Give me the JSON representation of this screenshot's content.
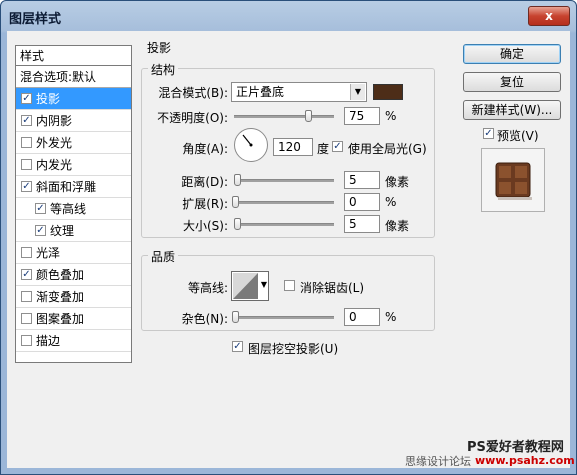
{
  "window": {
    "title": "图层样式",
    "close_label": "x"
  },
  "styles_panel": {
    "header": "样式",
    "blend_options": "混合选项:默认",
    "items": [
      {
        "label": "投影",
        "checked": true,
        "selected": true,
        "sub": false
      },
      {
        "label": "内阴影",
        "checked": true,
        "selected": false,
        "sub": false
      },
      {
        "label": "外发光",
        "checked": false,
        "selected": false,
        "sub": false
      },
      {
        "label": "内发光",
        "checked": false,
        "selected": false,
        "sub": false
      },
      {
        "label": "斜面和浮雕",
        "checked": true,
        "selected": false,
        "sub": false
      },
      {
        "label": "等高线",
        "checked": true,
        "selected": false,
        "sub": true
      },
      {
        "label": "纹理",
        "checked": true,
        "selected": false,
        "sub": true
      },
      {
        "label": "光泽",
        "checked": false,
        "selected": false,
        "sub": false
      },
      {
        "label": "颜色叠加",
        "checked": true,
        "selected": false,
        "sub": false
      },
      {
        "label": "渐变叠加",
        "checked": false,
        "selected": false,
        "sub": false
      },
      {
        "label": "图案叠加",
        "checked": false,
        "selected": false,
        "sub": false
      },
      {
        "label": "描边",
        "checked": false,
        "selected": false,
        "sub": false
      }
    ]
  },
  "drop_shadow": {
    "section_title": "投影",
    "structure": {
      "title": "结构",
      "blend_mode_label": "混合模式(B):",
      "blend_mode_value": "正片叠底",
      "shadow_color": "#4d2d18",
      "opacity_label": "不透明度(O):",
      "opacity_value": "75",
      "opacity_unit": "%",
      "opacity_fraction": 0.75,
      "angle_label": "角度(A):",
      "angle_value": "120",
      "angle_unit": "度",
      "global_light_label": "使用全局光(G)",
      "global_light_checked": true,
      "distance_label": "距离(D):",
      "distance_value": "5",
      "distance_unit": "像素",
      "spread_label": "扩展(R):",
      "spread_value": "0",
      "spread_unit": "%",
      "size_label": "大小(S):",
      "size_value": "5",
      "size_unit": "像素"
    },
    "quality": {
      "title": "品质",
      "contour_label": "等高线:",
      "anti_alias_label": "消除锯齿(L)",
      "anti_alias_checked": false,
      "noise_label": "杂色(N):",
      "noise_value": "0",
      "noise_unit": "%"
    },
    "knockout_label": "图层挖空投影(U)",
    "knockout_checked": true
  },
  "buttons": {
    "ok": "确定",
    "reset": "复位",
    "new_style": "新建样式(W)...",
    "preview_label": "预览(V)",
    "preview_checked": true
  },
  "watermark": {
    "line1": "PS爱好者教程网",
    "line2": "思缘设计论坛",
    "line3": "www.psahz.com"
  },
  "colors": {
    "selection": "#3399ff",
    "title_bar": "#a6bedb",
    "close_button": "#c7432f"
  }
}
